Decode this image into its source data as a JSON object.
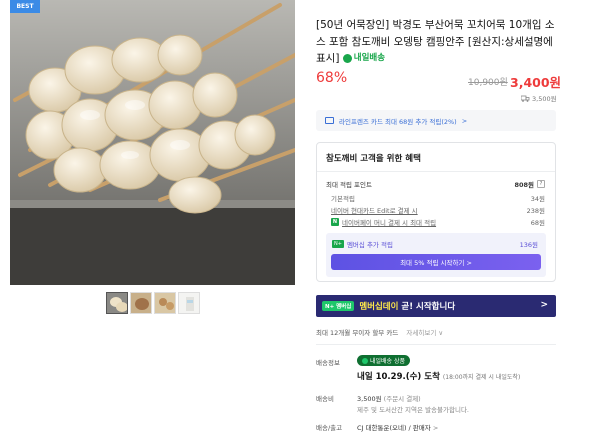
{
  "product": {
    "badge": "BEST",
    "title": "[50년 어묵장인] 박경도 부산어묵 꼬치어묵 10개입 소스 포함 참도깨비 오뎅탕 캠핑안주 [원산지:상세설명에 표시]",
    "tomorrow_label": "내일배송",
    "discount": "68%",
    "original_price": "10,900원",
    "sale_price": "3,400원",
    "shipping_fee": "3,500원"
  },
  "card_benefit": {
    "text": "라인프렌즈 카드 최대 68원 추가 적립(2%)",
    "chevron": ">"
  },
  "benefit_box": {
    "title": "참도깨비 고객을 위한 혜택",
    "max_points_label": "최대 적립 포인트",
    "max_points_value": "808원",
    "rows": [
      {
        "label": "기본적립",
        "value": "34원"
      },
      {
        "label": "네이버 현대카드 Edit로 결제 시",
        "value": "238원"
      },
      {
        "label": "네이버페이 머니 결제 시 최대 적립",
        "value": "68원"
      }
    ],
    "member_label": "멤버십 추가 적립",
    "member_badge": "N+",
    "member_value": "136원",
    "member_button": "최대 5% 적립 시작하기 >"
  },
  "banner": {
    "tag": "N+ 멤버십",
    "text_prefix": "멤버십데이",
    "text_suffix": " 곧! 시작합니다",
    "chevron": ">"
  },
  "installment": {
    "text": "최대 12개월 무이자 할부 카드",
    "more": "자세히보기 ∨"
  },
  "delivery": {
    "label": "배송정보",
    "badge": "내일배송 상품",
    "arrival": "내일 10.29.(수) 도착",
    "arrival_note": "(18:00까지 결제 시 내일도착)",
    "fee_label": "배송비",
    "fee_value": "3,500원",
    "fee_note": "(주문시 결제)",
    "fee_sub": "제주 및 도서산간 지역은 발송불가합니다.",
    "carrier_label": "배송/출고",
    "carrier_value": "CJ 대한통운(오네) / 판매자",
    "carrier_chevron": ">"
  },
  "colors": {
    "accent_red": "#ee3b3b",
    "naver_green": "#19a64b",
    "membership_purple": "#5d52e3",
    "banner_navy": "#2a2a72"
  }
}
